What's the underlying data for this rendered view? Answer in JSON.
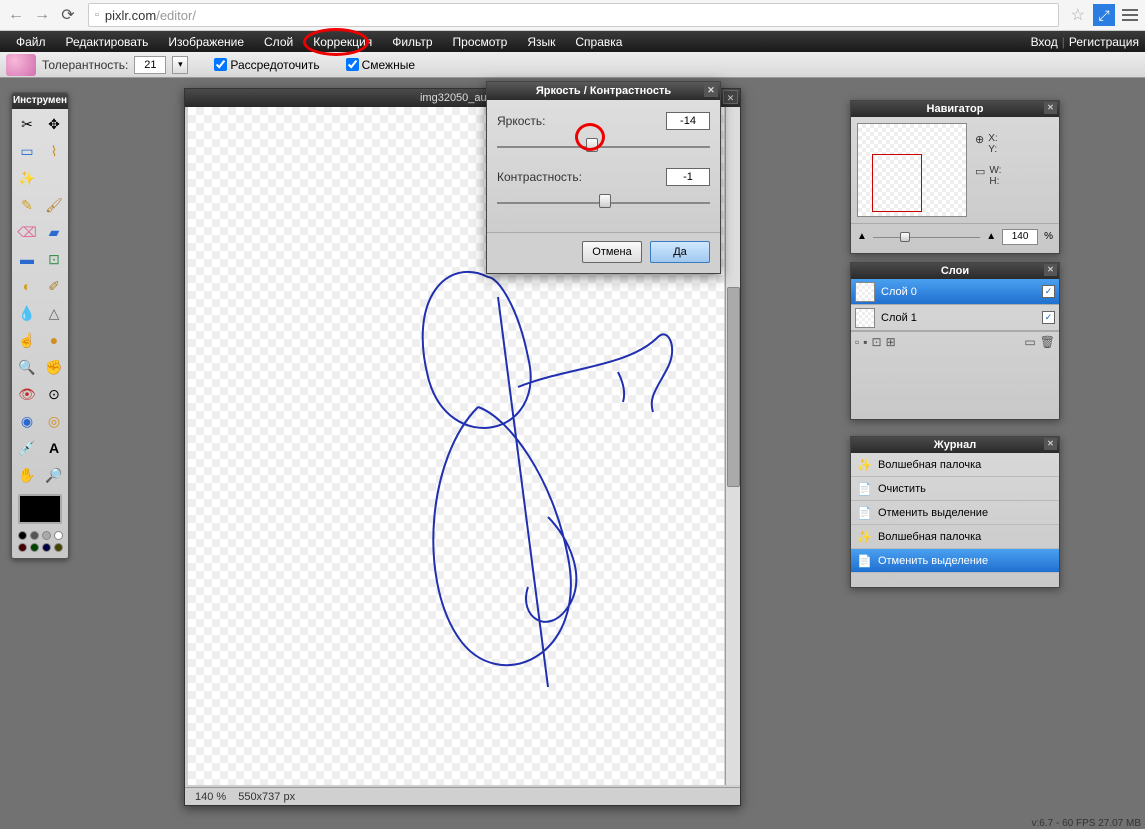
{
  "browser": {
    "url_host": "pixlr.com",
    "url_path": "/editor/"
  },
  "menu": [
    "Файл",
    "Редактировать",
    "Изображение",
    "Слой",
    "Коррекция",
    "Фильтр",
    "Просмотр",
    "Язык",
    "Справка"
  ],
  "menu_right": {
    "login": "Вход",
    "register": "Регистрация"
  },
  "options": {
    "tolerance_label": "Толерантность:",
    "tolerance_value": "21",
    "contiguous_label": "Рассредоточить",
    "antialiased_label": "Смежные"
  },
  "toolbox": {
    "title": "Инструмен"
  },
  "canvas": {
    "title": "img32050_auto...",
    "zoom": "140 %",
    "dimensions": "550x737 px"
  },
  "dialog": {
    "title": "Яркость / Контрастность",
    "brightness_label": "Яркость:",
    "brightness_value": "-14",
    "contrast_label": "Контрастность:",
    "contrast_value": "-1",
    "cancel": "Отмена",
    "ok": "Да"
  },
  "navigator": {
    "title": "Навигатор",
    "x_label": "X:",
    "y_label": "Y:",
    "w_label": "W:",
    "h_label": "H:",
    "zoom_value": "140",
    "zoom_unit": "%"
  },
  "layers": {
    "title": "Слои",
    "items": [
      {
        "name": "Слой 0",
        "visible": true,
        "selected": true
      },
      {
        "name": "Слой 1",
        "visible": true,
        "selected": false
      }
    ]
  },
  "history": {
    "title": "Журнал",
    "items": [
      {
        "label": "Волшебная палочка",
        "selected": false,
        "icon": "wand"
      },
      {
        "label": "Очистить",
        "selected": false,
        "icon": "doc"
      },
      {
        "label": "Отменить выделение",
        "selected": false,
        "icon": "doc"
      },
      {
        "label": "Волшебная палочка",
        "selected": false,
        "icon": "wand"
      },
      {
        "label": "Отменить выделение",
        "selected": true,
        "icon": "doc"
      }
    ]
  },
  "status": "v:6.7 - 60 FPS 27.07 MB"
}
